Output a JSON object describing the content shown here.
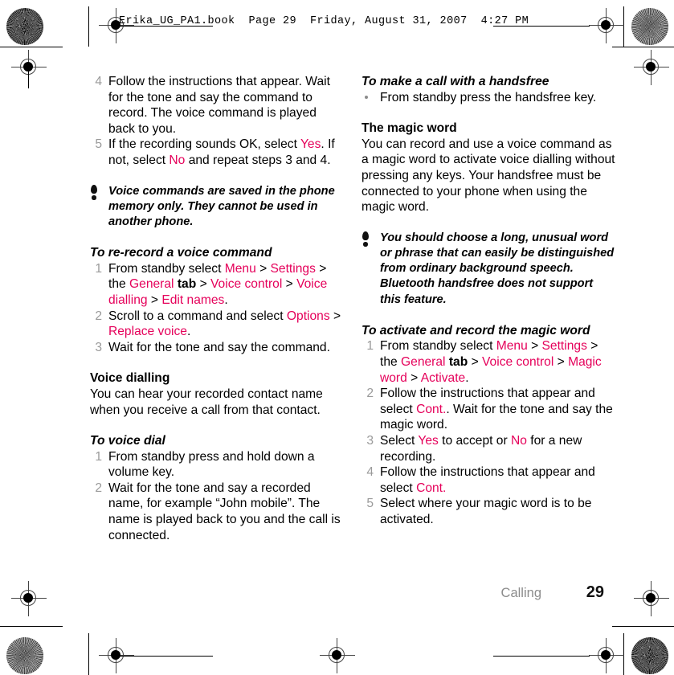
{
  "header": {
    "slug": "Erika_UG_PA1.book  Page 29  Friday, August 31, 2007  4:27 PM"
  },
  "colors": {
    "ui_accent": "#e5005a",
    "step_number": "#9a9a9a",
    "chapter_label": "#8c8c8c",
    "page_background": "#ffffff",
    "body_text": "#000000"
  },
  "left_column": {
    "continued_steps": [
      {
        "num": "4",
        "parts": [
          {
            "text": "Follow the instructions that appear. Wait for the tone and say the command to record. The voice command is played back to you.",
            "style": "plain"
          }
        ]
      },
      {
        "num": "5",
        "parts": [
          {
            "text": "If the recording sounds OK, select ",
            "style": "plain"
          },
          {
            "text": "Yes",
            "style": "ui"
          },
          {
            "text": ". If not, select ",
            "style": "plain"
          },
          {
            "text": "No",
            "style": "ui"
          },
          {
            "text": " and repeat steps 3 and 4.",
            "style": "plain"
          }
        ]
      }
    ],
    "note_1": {
      "icon": "exclamation-icon",
      "text": "Voice commands are saved in the phone memory only. They cannot be used in another phone."
    },
    "proc_1": {
      "heading": "To re-record a voice command",
      "steps": [
        {
          "num": "1",
          "parts": [
            {
              "text": "From standby select ",
              "style": "plain"
            },
            {
              "text": "Menu",
              "style": "ui"
            },
            {
              "text": " > ",
              "style": "plain"
            },
            {
              "text": "Settings",
              "style": "ui"
            },
            {
              "text": " > the ",
              "style": "plain"
            },
            {
              "text": "General",
              "style": "ui"
            },
            {
              "text": " tab",
              "style": "bold"
            },
            {
              "text": " > ",
              "style": "plain"
            },
            {
              "text": "Voice control",
              "style": "ui"
            },
            {
              "text": " > ",
              "style": "plain"
            },
            {
              "text": "Voice dialling",
              "style": "ui"
            },
            {
              "text": " > ",
              "style": "plain"
            },
            {
              "text": "Edit names",
              "style": "ui"
            },
            {
              "text": ".",
              "style": "plain"
            }
          ]
        },
        {
          "num": "2",
          "parts": [
            {
              "text": "Scroll to a command and select ",
              "style": "plain"
            },
            {
              "text": "Options",
              "style": "ui"
            },
            {
              "text": " > ",
              "style": "plain"
            },
            {
              "text": "Replace voice",
              "style": "ui"
            },
            {
              "text": ".",
              "style": "plain"
            }
          ]
        },
        {
          "num": "3",
          "parts": [
            {
              "text": "Wait for the tone and say the command.",
              "style": "plain"
            }
          ]
        }
      ]
    },
    "section_1": {
      "heading": "Voice dialling",
      "body": "You can hear your recorded contact name when you receive a call from that contact."
    },
    "proc_2": {
      "heading": "To voice dial",
      "steps": [
        {
          "num": "1",
          "parts": [
            {
              "text": "From standby press and hold down a volume key.",
              "style": "plain"
            }
          ]
        },
        {
          "num": "2",
          "parts": [
            {
              "text": "Wait for the tone and say a recorded name, for example “John mobile”. The name is played back to you and the call is connected.",
              "style": "plain"
            }
          ]
        }
      ]
    }
  },
  "right_column": {
    "proc_3": {
      "heading": "To make a call with a handsfree",
      "bullets": [
        {
          "parts": [
            {
              "text": "From standby press the handsfree key.",
              "style": "plain"
            }
          ]
        }
      ]
    },
    "section_2": {
      "heading": "The magic word",
      "body": "You can record and use a voice command as a magic word to activate voice dialling without pressing any keys. Your handsfree must be connected to your phone when using the magic word."
    },
    "note_2": {
      "icon": "exclamation-icon",
      "text": "You should choose a long, unusual word or phrase that can easily be distinguished from ordinary background speech. Bluetooth handsfree does not support this feature."
    },
    "proc_4": {
      "heading": "To activate and record the magic word",
      "steps": [
        {
          "num": "1",
          "parts": [
            {
              "text": "From standby select ",
              "style": "plain"
            },
            {
              "text": "Menu",
              "style": "ui"
            },
            {
              "text": " > ",
              "style": "plain"
            },
            {
              "text": "Settings",
              "style": "ui"
            },
            {
              "text": " > the ",
              "style": "plain"
            },
            {
              "text": "General",
              "style": "ui"
            },
            {
              "text": " tab",
              "style": "bold"
            },
            {
              "text": " > ",
              "style": "plain"
            },
            {
              "text": "Voice control",
              "style": "ui"
            },
            {
              "text": " > ",
              "style": "plain"
            },
            {
              "text": "Magic word",
              "style": "ui"
            },
            {
              "text": " > ",
              "style": "plain"
            },
            {
              "text": "Activate",
              "style": "ui"
            },
            {
              "text": ".",
              "style": "plain"
            }
          ]
        },
        {
          "num": "2",
          "parts": [
            {
              "text": "Follow the instructions that appear and select ",
              "style": "plain"
            },
            {
              "text": "Cont.",
              "style": "ui"
            },
            {
              "text": ". Wait for the tone and say the magic word.",
              "style": "plain"
            }
          ]
        },
        {
          "num": "3",
          "parts": [
            {
              "text": "Select ",
              "style": "plain"
            },
            {
              "text": "Yes",
              "style": "ui"
            },
            {
              "text": " to accept or ",
              "style": "plain"
            },
            {
              "text": "No",
              "style": "ui"
            },
            {
              "text": " for a new recording.",
              "style": "plain"
            }
          ]
        },
        {
          "num": "4",
          "parts": [
            {
              "text": "Follow the instructions that appear and select ",
              "style": "plain"
            },
            {
              "text": "Cont.",
              "style": "ui"
            }
          ]
        },
        {
          "num": "5",
          "parts": [
            {
              "text": "Select where your magic word is to be activated.",
              "style": "plain"
            }
          ]
        }
      ]
    }
  },
  "footer": {
    "chapter": "Calling",
    "page_number": "29"
  }
}
